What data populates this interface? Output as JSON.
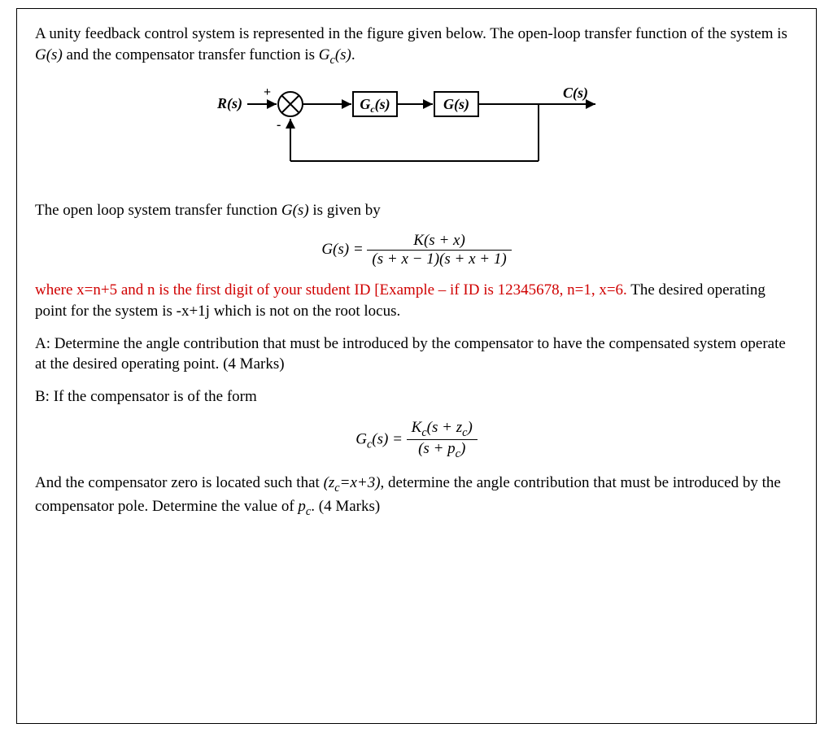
{
  "para1_a": "A unity feedback control system is represented in the figure given below. The open-loop transfer function of the system is ",
  "para1_b": "G(s)",
  "para1_c": " and the compensator transfer function is ",
  "para1_d": "G",
  "para1_e": "(s)",
  "para1_f": ".",
  "sub_c": "c",
  "diagram": {
    "R": "R(s)",
    "plus": "+",
    "minus": "-",
    "Gc": "G",
    "Gc_sub": "c",
    "Gc_tail": "(s)",
    "G": "G(s)",
    "C": "C(s)"
  },
  "para2_a": "The open loop system transfer function ",
  "para2_b": "G(s)",
  "para2_c": " is given by",
  "eq1_lhs": "G(s) = ",
  "eq1_num": "K(s + x)",
  "eq1_den": "(s + x − 1)(s + x + 1)",
  "para3_red": "where x=n+5 and n is the first digit of your student ID [Example – if ID is 12345678, n=1, x=6. ",
  "para3_black": "The desired operating point for the system is -x+1j which is not on the root locus.",
  "para4": "A: Determine the angle contribution that must be introduced by the compensator to have the compensated system operate at the desired operating point. (4 Marks)",
  "para5": "B: If the compensator is of the form",
  "eq2_lhs_a": "G",
  "eq2_lhs_b": "(s) = ",
  "eq2_num_a": "K",
  "eq2_num_b": "(s + z",
  "eq2_num_c": ")",
  "eq2_den_a": "(s + p",
  "eq2_den_b": ")",
  "para6_a": "And the compensator zero is located such that ",
  "para6_b": "(z",
  "para6_c": "=x+3)",
  "para6_d": ", determine the angle contribution that must be introduced by the compensator pole. Determine the value of ",
  "para6_e": "p",
  "para6_f": ". (4 Marks)"
}
